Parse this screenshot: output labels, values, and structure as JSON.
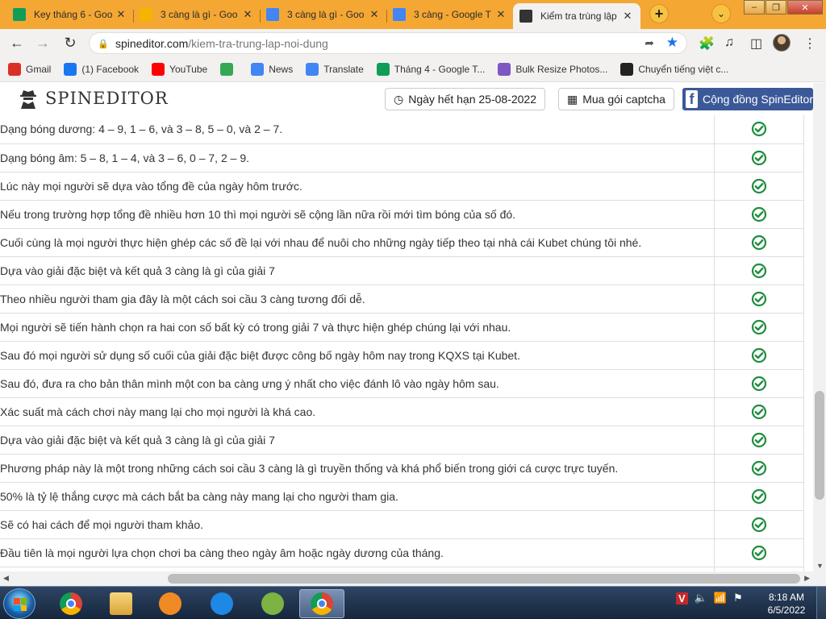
{
  "browser": {
    "tabs": [
      {
        "title": "Key tháng 6 - Goo",
        "icon": "google-sheets-icon",
        "color": "#0f9d58",
        "active": false
      },
      {
        "title": "3 càng là gì - Goo",
        "icon": "google-drive-icon",
        "color": "#f4b400",
        "active": false
      },
      {
        "title": "3 càng là gì - Goo",
        "icon": "google-docs-icon",
        "color": "#4285f4",
        "active": false
      },
      {
        "title": "3 càng - Google T",
        "icon": "google-icon",
        "color": "#4285f4",
        "active": false
      },
      {
        "title": "Kiểm tra trùng lập",
        "icon": "spineditor-icon",
        "color": "#333333",
        "active": true
      }
    ],
    "new_tab_symbol": "+",
    "tab_search_symbol": "⌄",
    "url_host": "spineditor.com",
    "url_path": "/kiem-tra-trung-lap-noi-dung",
    "bookmarks": [
      {
        "label": "Gmail",
        "icon": "gmail-icon",
        "color": "#d93025"
      },
      {
        "label": "(1) Facebook",
        "icon": "facebook-icon",
        "color": "#1877f2"
      },
      {
        "label": "YouTube",
        "icon": "youtube-icon",
        "color": "#ff0000"
      },
      {
        "label": "",
        "icon": "maps-icon",
        "color": "#34a853"
      },
      {
        "label": "News",
        "icon": "google-news-icon",
        "color": "#4285f4"
      },
      {
        "label": "Translate",
        "icon": "translate-icon",
        "color": "#4285f4"
      },
      {
        "label": "Tháng 4 - Google T...",
        "icon": "google-sheets-icon",
        "color": "#0f9d58"
      },
      {
        "label": "Bulk Resize Photos...",
        "icon": "bulk-resize-icon",
        "color": "#7e57c2"
      },
      {
        "label": "Chuyển tiếng việt c...",
        "icon": "globe-icon",
        "color": "#222222"
      }
    ]
  },
  "site": {
    "logo_text": "SPINEDITOR",
    "expiry_label": "Ngày hết hạn 25-08-2022",
    "captcha_label": "Mua gói captcha",
    "community_label": "Cộng đồng SpinEditor",
    "accent": "#3b5998",
    "check_color": "#1e8e3e"
  },
  "rows": [
    {
      "text": "Dạng bóng dương: 4 – 9, 1 – 6, và 3 – 8, 5 – 0, và 2 – 7.",
      "status": "check"
    },
    {
      "text": "Dạng bóng âm: 5 – 8, 1 – 4, và 3 – 6, 0 – 7, 2 – 9.",
      "status": "check"
    },
    {
      "text": "Lúc này mọi người sẽ dựa vào tổng đề của ngày hôm trước.",
      "status": "check"
    },
    {
      "text": "Nếu trong trường hợp tổng đề nhiều hơn 10 thì mọi người sẽ cộng lần nữa rồi mới tìm bóng của số đó.",
      "status": "check"
    },
    {
      "text": "Cuối cùng là mọi người thực hiện ghép các số đề lại với nhau để nuôi cho những ngày tiếp theo tại nhà cái Kubet chúng tôi nhé.",
      "status": "check"
    },
    {
      "text": "Dựa vào giải đặc biệt và kết quả 3 càng là gì của giải 7",
      "status": "check"
    },
    {
      "text": "Theo nhiều người tham gia đây là một cách soi cầu 3 càng tương đối dễ.",
      "status": "check"
    },
    {
      "text": "Mọi người sẽ tiến hành chọn ra hai con số bất kỳ có trong giải 7 và thực hiện ghép chúng lại với nhau.",
      "status": "check"
    },
    {
      "text": "Sau đó mọi người sử dụng số cuối của giải đặc biệt được công bố ngày hôm nay trong KQXS tại Kubet.",
      "status": "check"
    },
    {
      "text": "Sau đó, đưa ra cho bản thân mình một con ba càng ưng ý nhất cho việc đánh lô vào ngày hôm sau.",
      "status": "check"
    },
    {
      "text": "Xác suất mà cách chơi này mang lại cho mọi người là khá cao.",
      "status": "check"
    },
    {
      "text": "Dựa vào giải đặc biệt và kết quả 3 càng là gì của giải 7",
      "status": "check"
    },
    {
      "text": "Phương pháp này là một trong những cách soi cầu 3 càng là gì truyền thống và khá phổ biến trong giới cá cược trực tuyến.",
      "status": "check"
    },
    {
      "text": "50% là tỷ lệ thắng cược mà cách bắt ba càng này mang lại cho người tham gia.",
      "status": "check"
    },
    {
      "text": "Sẽ có hai cách để mọi người tham khảo.",
      "status": "check"
    },
    {
      "text": "Đầu tiên là mọi người lựa chọn chơi ba càng theo ngày âm hoặc ngày dương của tháng.",
      "status": "check"
    },
    {
      "text": "",
      "status": "check"
    }
  ],
  "taskbar": {
    "apps": [
      {
        "name": "chrome-app",
        "color": "#4285f4"
      },
      {
        "name": "file-explorer-app",
        "color": "#e8b84a"
      },
      {
        "name": "media-player-app",
        "color": "#f08a24"
      },
      {
        "name": "internet-explorer-app",
        "color": "#1e88e5"
      },
      {
        "name": "coccoc-app",
        "color": "#7cb342"
      },
      {
        "name": "chrome-profile-app",
        "color": "#4285f4"
      }
    ],
    "time": "8:18 AM",
    "date": "6/5/2022"
  }
}
